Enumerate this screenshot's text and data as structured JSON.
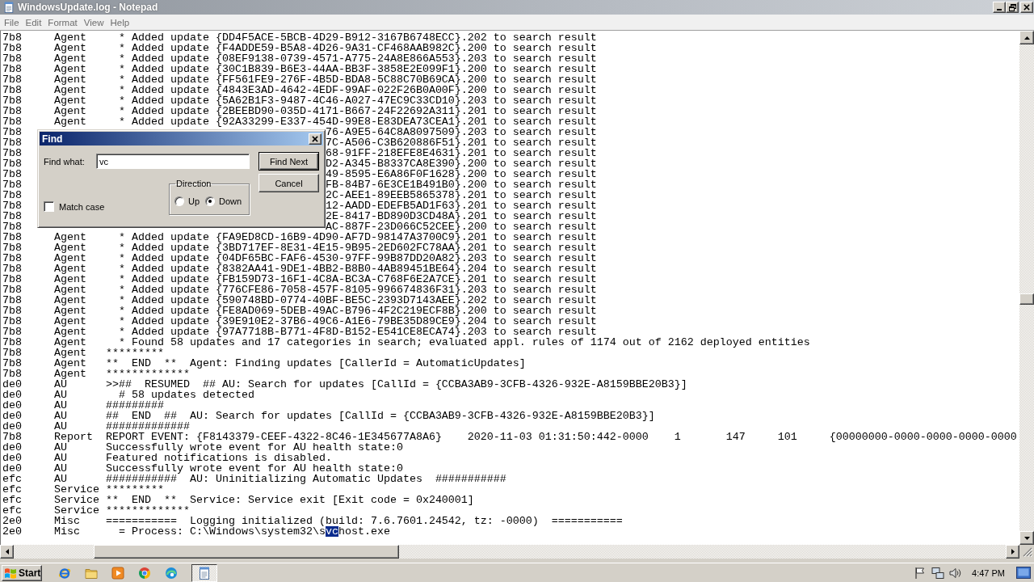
{
  "window": {
    "title": "WindowsUpdate.log - Notepad"
  },
  "menu": [
    "File",
    "Edit",
    "Format",
    "View",
    "Help"
  ],
  "log": {
    "lines": [
      {
        "kind": "text",
        "thread": "7b8",
        "component": "Agent",
        "message": "  * Added update {DD4F5ACE-5BCB-4D29-B912-3167B6748ECC}.202 to search result"
      },
      {
        "kind": "text",
        "thread": "7b8",
        "component": "Agent",
        "message": "  * Added update {F4ADDE59-B5A8-4D26-9A31-CF468AAB982C}.200 to search result"
      },
      {
        "kind": "text",
        "thread": "7b8",
        "component": "Agent",
        "message": "  * Added update {08EF9138-0739-4571-A775-24A8E866A553}.203 to search result"
      },
      {
        "kind": "text",
        "thread": "7b8",
        "component": "Agent",
        "message": "  * Added update {30C1B839-B6E3-44AA-BB3F-3858E2E099F1}.200 to search result"
      },
      {
        "kind": "text",
        "thread": "7b8",
        "component": "Agent",
        "message": "  * Added update {FF561FE9-276F-4B5D-BDA8-5C88C70B69CA}.200 to search result"
      },
      {
        "kind": "text",
        "thread": "7b8",
        "component": "Agent",
        "message": "  * Added update {4843E3AD-4642-4EDF-99AF-022F26B0A00F}.200 to search result"
      },
      {
        "kind": "text",
        "thread": "7b8",
        "component": "Agent",
        "message": "  * Added update {5A62B1F3-9487-4C46-A027-47EC9C33CD10}.203 to search result"
      },
      {
        "kind": "text",
        "thread": "7b8",
        "component": "Agent",
        "message": "  * Added update {2BEEBD90-035D-4171-B667-24F22692A311}.201 to search result"
      },
      {
        "kind": "text",
        "thread": "7b8",
        "component": "Agent",
        "message": "  * Added update {92A33299-E337-454D-99E8-E83DEA73CEA1}.201 to search result"
      },
      {
        "kind": "covered",
        "thread": "7b8",
        "tail": "76-A9E5-64C8A8097509}.203 to search result"
      },
      {
        "kind": "covered",
        "thread": "7b8",
        "tail": "7C-A506-C3B620886F51}.201 to search result"
      },
      {
        "kind": "covered",
        "thread": "7b8",
        "tail": "68-91FF-218EFE8E4631}.201 to search result"
      },
      {
        "kind": "covered",
        "thread": "7b8",
        "tail": "D2-A345-B8337CA8E390}.200 to search result"
      },
      {
        "kind": "covered",
        "thread": "7b8",
        "tail": "49-8595-E6A86F0F1628}.200 to search result"
      },
      {
        "kind": "covered",
        "thread": "7b8",
        "tail": "FB-84B7-6E3CE1B491B0}.200 to search result"
      },
      {
        "kind": "covered",
        "thread": "7b8",
        "tail": "2C-AEE1-89EEB5865378}.201 to search result"
      },
      {
        "kind": "covered",
        "thread": "7b8",
        "tail": "12-AADD-EDEFB5AD1F63}.201 to search result"
      },
      {
        "kind": "covered",
        "thread": "7b8",
        "tail": "2E-8417-BD890D3CD48A}.201 to search result"
      },
      {
        "kind": "covered",
        "thread": "7b8",
        "tail": "AC-887F-23D066C52CEE}.200 to search result"
      },
      {
        "kind": "text",
        "thread": "7b8",
        "component": "Agent",
        "message": "  * Added update {FA9ED8CD-16B9-4D90-AF7D-98147A3700C9}.201 to search result"
      },
      {
        "kind": "text",
        "thread": "7b8",
        "component": "Agent",
        "message": "  * Added update {3BD717EF-8E31-4E15-9B95-2ED602FC78AA}.201 to search result"
      },
      {
        "kind": "text",
        "thread": "7b8",
        "component": "Agent",
        "message": "  * Added update {04DF65BC-FAF6-4530-97FF-99B87DD20A82}.203 to search result"
      },
      {
        "kind": "text",
        "thread": "7b8",
        "component": "Agent",
        "message": "  * Added update {8382AA41-9DE1-4BB2-B8B0-4AB89451BE64}.204 to search result"
      },
      {
        "kind": "text",
        "thread": "7b8",
        "component": "Agent",
        "message": "  * Added update {FB159D73-16F1-4C8A-BC3A-C768F6E2A7CE}.201 to search result"
      },
      {
        "kind": "text",
        "thread": "7b8",
        "component": "Agent",
        "message": "  * Added update {776CFE86-7058-457F-8105-996674836F31}.203 to search result"
      },
      {
        "kind": "text",
        "thread": "7b8",
        "component": "Agent",
        "message": "  * Added update {590748BD-0774-40BF-BE5C-2393D7143AEE}.202 to search result"
      },
      {
        "kind": "text",
        "thread": "7b8",
        "component": "Agent",
        "message": "  * Added update {FE8AD069-5DEB-49AC-B796-4F2C219ECF8B}.200 to search result"
      },
      {
        "kind": "text",
        "thread": "7b8",
        "component": "Agent",
        "message": "  * Added update {39E910E2-37B6-49C6-A1E6-79BE35D89CE9}.204 to search result"
      },
      {
        "kind": "text",
        "thread": "7b8",
        "component": "Agent",
        "message": "  * Added update {97A7718B-B771-4F8D-B152-E541CE8ECA74}.203 to search result"
      },
      {
        "kind": "text",
        "thread": "7b8",
        "component": "Agent",
        "message": "  * Found 58 updates and 17 categories in search; evaluated appl. rules of 1174 out of 2162 deployed entities"
      },
      {
        "kind": "text",
        "thread": "7b8",
        "component": "Agent",
        "message": "*********"
      },
      {
        "kind": "text",
        "thread": "7b8",
        "component": "Agent",
        "message": "**  END  **  Agent: Finding updates [CallerId = AutomaticUpdates]"
      },
      {
        "kind": "text",
        "thread": "7b8",
        "component": "Agent",
        "message": "*************"
      },
      {
        "kind": "text",
        "thread": "de0",
        "component": "AU",
        "message": ">>##  RESUMED  ## AU: Search for updates [CallId = {CCBA3AB9-3CFB-4326-932E-A8159BBE20B3}]"
      },
      {
        "kind": "text",
        "thread": "de0",
        "component": "AU",
        "message": "  # 58 updates detected"
      },
      {
        "kind": "text",
        "thread": "de0",
        "component": "AU",
        "message": "#########"
      },
      {
        "kind": "text",
        "thread": "de0",
        "component": "AU",
        "message": "##  END  ##  AU: Search for updates [CallId = {CCBA3AB9-3CFB-4326-932E-A8159BBE20B3}]"
      },
      {
        "kind": "text",
        "thread": "de0",
        "component": "AU",
        "message": "#############"
      },
      {
        "kind": "text",
        "thread": "7b8",
        "component": "Report",
        "message": "REPORT EVENT: {F8143379-CEEF-4322-8C46-1E345677A8A6}    2020-11-03 01:31:50:442-0000    1       147     101     {00000000-0000-0000-0000-0000"
      },
      {
        "kind": "text",
        "thread": "de0",
        "component": "AU",
        "message": "Successfully wrote event for AU health state:0"
      },
      {
        "kind": "text",
        "thread": "de0",
        "component": "AU",
        "message": "Featured notifications is disabled."
      },
      {
        "kind": "text",
        "thread": "de0",
        "component": "AU",
        "message": "Successfully wrote event for AU health state:0"
      },
      {
        "kind": "text",
        "thread": "efc",
        "component": "AU",
        "message": "###########  AU: Uninitializing Automatic Updates  ###########"
      },
      {
        "kind": "text",
        "thread": "efc",
        "component": "Service",
        "message": "*********"
      },
      {
        "kind": "text",
        "thread": "efc",
        "component": "Service",
        "message": "**  END  **  Service: Service exit [Exit code = 0x240001]"
      },
      {
        "kind": "text",
        "thread": "efc",
        "component": "Service",
        "message": "*************"
      },
      {
        "kind": "text",
        "thread": "2e0",
        "component": "Misc",
        "message": "===========  Logging initialized (build: 7.6.7601.24542, tz: -0000)  ==========="
      },
      {
        "kind": "selection",
        "thread": "2e0",
        "component": "Misc",
        "message": "  = Process: C:\\Windows\\system32\\s",
        "match": "vc",
        "after": "host.exe"
      }
    ]
  },
  "find_dialog": {
    "title": "Find",
    "find_what": {
      "label": "Find what:",
      "value": "vc"
    },
    "find_next_button": "Find Next",
    "cancel_button": "Cancel",
    "direction": {
      "label": "Direction",
      "options": [
        {
          "label": "Up",
          "selected": false
        },
        {
          "label": "Down",
          "selected": true
        }
      ]
    },
    "match_case": {
      "label": "Match case",
      "checked": false
    }
  },
  "taskbar": {
    "start": "Start",
    "apps": [
      {
        "kind": "globe_e",
        "selected": false
      },
      {
        "kind": "folder",
        "selected": false
      },
      {
        "kind": "play",
        "selected": false
      },
      {
        "kind": "tricolor",
        "selected": false
      },
      {
        "kind": "swirl",
        "selected": false
      },
      {
        "kind": "notepad",
        "selected": true
      }
    ],
    "clock": "4:47 PM"
  }
}
